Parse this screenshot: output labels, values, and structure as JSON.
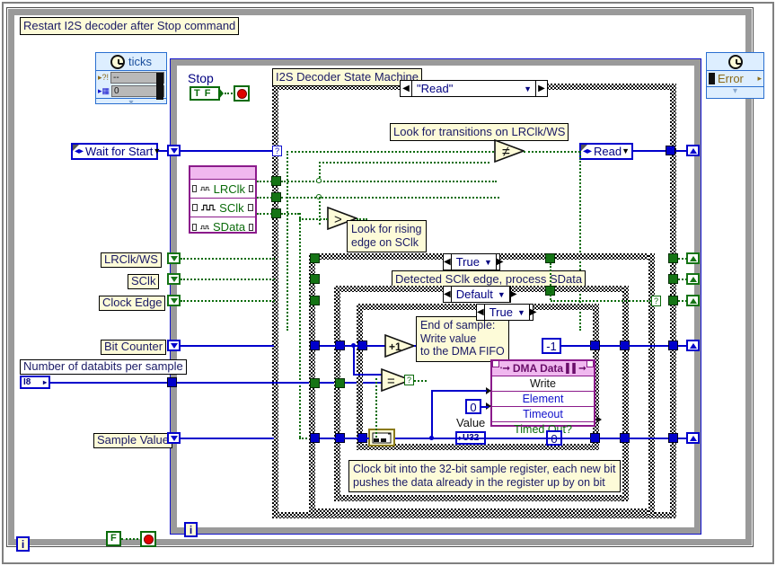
{
  "diagram": {
    "title_comment": "Restart I2S decoder after Stop command",
    "state_machine_label": "I2S Decoder State Machine",
    "case_selector_top": "\"Read\"",
    "comments": {
      "lrclk_transitions": "Look for transitions on LRClk/WS",
      "rising_edge": "Look for rising\nedge on SClk",
      "detected_edge": "Detected SClk edge, process SData",
      "end_of_sample": "End of sample:\nWrite value\nto the DMA FIFO",
      "clock_bit": "Clock bit into the 32-bit sample register, each new bit\npushes the data already in the register up by on bit"
    },
    "case_selectors": {
      "outer_true": "True",
      "default": "Default",
      "inner_true": "True"
    },
    "controls": {
      "stop_label": "Stop",
      "stop_value": "T F",
      "wait_for_start": "Wait for Start",
      "read_enum": "Read",
      "number_of_databits_label": "Number of databits per sample",
      "databits_type": "I8",
      "sample_value_label": "Sample Value",
      "value_label": "Value",
      "value_type": "U32",
      "false_const": "F"
    },
    "terminals": [
      {
        "label": "LRClk/WS"
      },
      {
        "label": "SClk"
      },
      {
        "label": "Clock Edge"
      },
      {
        "label": "Bit Counter"
      }
    ],
    "signal_node": {
      "signals": [
        "LRClk",
        "SClk",
        "SData"
      ]
    },
    "fifo_node": {
      "title": "DMA Data",
      "rows": [
        "Write",
        "Element",
        "Timeout",
        "Timed Out?"
      ]
    },
    "ticks_node": {
      "title": "ticks",
      "field_1": "--",
      "field_2": "0"
    },
    "error_node": {
      "label": "Error"
    },
    "constants": {
      "minus_one": "-1",
      "zero_timeout": "0",
      "zero_bottom": "0"
    },
    "functions": {
      "not_equal": "≠",
      "greater_than": ">",
      "increment": "+1",
      "equals": "="
    },
    "iteration_terminals": [
      "i",
      "i"
    ],
    "colors": {
      "wire_blue": "#0000cc",
      "wire_green": "#0a6b0a",
      "comment_bg": "#fdfbd8",
      "loop_grey": "#9a9a9a",
      "fifo_purple": "#8b1a8b",
      "node_blue": "#ddeeff"
    }
  }
}
